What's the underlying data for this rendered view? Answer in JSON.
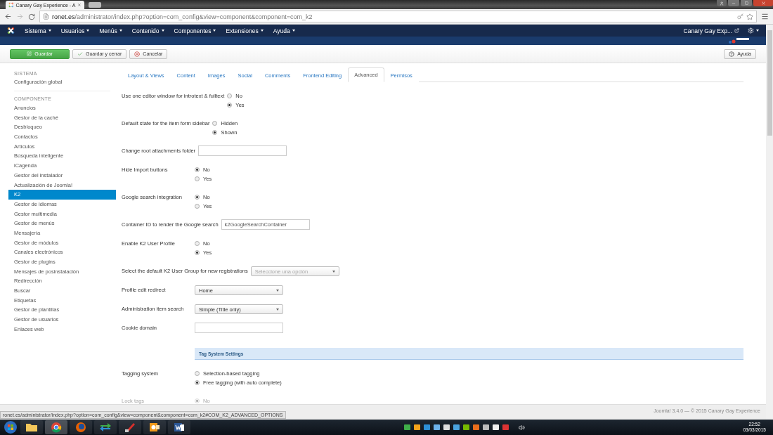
{
  "browser": {
    "tab_title": "Canary Gay Experience - A",
    "url_host": "ronet.es",
    "url_path": "/administrator/index.php?option=com_config&view=component&component=com_k2"
  },
  "navbar": {
    "menus": [
      "Sistema",
      "Usuarios",
      "Menús",
      "Contenido",
      "Componentes",
      "Extensiones",
      "Ayuda"
    ],
    "site_link": "Canary Gay Exp..."
  },
  "toolbar": {
    "buttons": [
      {
        "label": "Guardar",
        "kind": "save"
      },
      {
        "label": "Guardar y cerrar",
        "kind": "check"
      },
      {
        "label": "Cancelar",
        "kind": "cancel"
      }
    ],
    "help": "Ayuda"
  },
  "sidebar": {
    "sections": [
      {
        "heading": "SISTEMA",
        "items": [
          {
            "label": "Configuración global",
            "selected": false
          }
        ]
      },
      {
        "heading": "COMPONENTE",
        "items": [
          {
            "label": "Anuncios",
            "selected": false
          },
          {
            "label": "Gestor de la caché",
            "selected": false
          },
          {
            "label": "Desbloqueo",
            "selected": false
          },
          {
            "label": "Contactos",
            "selected": false
          },
          {
            "label": "Artículos",
            "selected": false
          },
          {
            "label": "Búsqueda inteligente",
            "selected": false
          },
          {
            "label": "iCagenda",
            "selected": false
          },
          {
            "label": "Gestor del instalador",
            "selected": false
          },
          {
            "label": "Actualización de Joomla!",
            "selected": false
          },
          {
            "label": "K2",
            "selected": true
          },
          {
            "label": "Gestor de idiomas",
            "selected": false
          },
          {
            "label": "Gestor multimedia",
            "selected": false
          },
          {
            "label": "Gestor de menús",
            "selected": false
          },
          {
            "label": "Mensajería",
            "selected": false
          },
          {
            "label": "Gestor de módulos",
            "selected": false
          },
          {
            "label": "Canales electrónicos",
            "selected": false
          },
          {
            "label": "Gestor de plugins",
            "selected": false
          },
          {
            "label": "Mensajes de posinstalación",
            "selected": false
          },
          {
            "label": "Redirección",
            "selected": false
          },
          {
            "label": "Buscar",
            "selected": false
          },
          {
            "label": "Etiquetas",
            "selected": false
          },
          {
            "label": "Gestor de plantillas",
            "selected": false
          },
          {
            "label": "Gestor de usuarios",
            "selected": false
          },
          {
            "label": "Enlaces web",
            "selected": false
          }
        ]
      }
    ]
  },
  "tabs": [
    {
      "label": "Layout & Views",
      "selected": false
    },
    {
      "label": "Content",
      "selected": false
    },
    {
      "label": "Images",
      "selected": false
    },
    {
      "label": "Social",
      "selected": false
    },
    {
      "label": "Comments",
      "selected": false
    },
    {
      "label": "Frontend Editing",
      "selected": false
    },
    {
      "label": "Advanced",
      "selected": true
    },
    {
      "label": "Permisos",
      "selected": false
    }
  ],
  "form": {
    "rows": [
      {
        "kind": "radio",
        "label": "Use one editor window for introtext & fulltext",
        "disabled": false,
        "options": [
          {
            "label": "No",
            "selected": false
          },
          {
            "label": "Yes",
            "selected": true
          }
        ]
      },
      {
        "kind": "radio",
        "label": "Default state for the item form sidebar",
        "disabled": false,
        "options": [
          {
            "label": "Hidden",
            "selected": false
          },
          {
            "label": "Shown",
            "selected": true
          }
        ]
      },
      {
        "kind": "text",
        "label": "Change root attachments folder",
        "disabled": false
      },
      {
        "kind": "radio",
        "label": "Hide Import buttons",
        "disabled": false,
        "options": [
          {
            "label": "No",
            "selected": true
          },
          {
            "label": "Yes",
            "selected": false
          }
        ]
      },
      {
        "kind": "radio",
        "label": "Google search integration",
        "disabled": false,
        "options": [
          {
            "label": "No",
            "selected": true
          },
          {
            "label": "Yes",
            "selected": false
          }
        ]
      },
      {
        "kind": "text",
        "label": "Container ID to render the Google search",
        "value": "k2GoogleSearchContainer",
        "disabled": false
      },
      {
        "kind": "radio",
        "label": "Enable K2 User Profile",
        "disabled": false,
        "options": [
          {
            "label": "No",
            "selected": false
          },
          {
            "label": "Yes",
            "selected": true
          }
        ]
      },
      {
        "kind": "select",
        "label": "Select the default K2 User Group for new registrations",
        "placeholder": "Seleccione una opción",
        "disabled": false
      },
      {
        "kind": "select",
        "label": "Profile edit redirect",
        "value": "Home",
        "disabled": false
      },
      {
        "kind": "select",
        "label": "Administration item search",
        "value": "Simple (Title only)",
        "disabled": false
      },
      {
        "kind": "text",
        "label": "Cookie domain",
        "disabled": false
      },
      {
        "kind": "header",
        "label": "Tag System Settings"
      },
      {
        "kind": "radio",
        "label": "Tagging system",
        "disabled": false,
        "options": [
          {
            "label": "Selection-based tagging",
            "selected": false
          },
          {
            "label": "Free tagging (with auto complete)",
            "selected": true
          }
        ]
      },
      {
        "kind": "radio",
        "label": "Lock tags",
        "disabled": true,
        "options": [
          {
            "label": "No",
            "selected": true
          }
        ]
      }
    ]
  },
  "footer": {
    "copyright": "Joomla! 3.4.0 — © 2015 Canary Gay Experience"
  },
  "status_url": "ronet.es/administrator/index.php?option=com_config&view=component&component=com_k2#COM_K2_ADVANCED_OPTIONS",
  "taskbar": {
    "time": "22:52",
    "date": "03/03/2015"
  }
}
